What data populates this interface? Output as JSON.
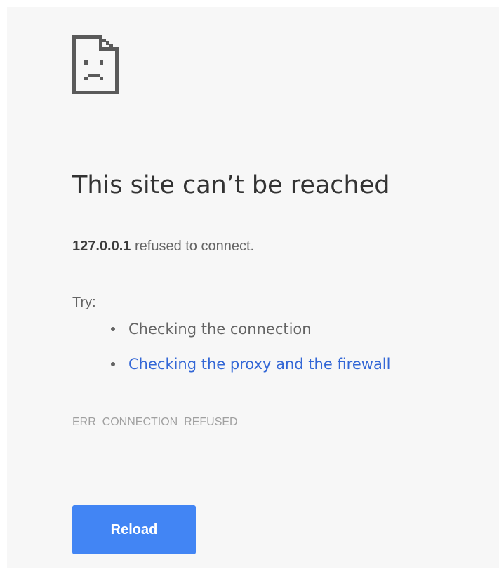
{
  "icon": "sad-page-icon",
  "title": "This site can’t be reached",
  "summary": {
    "host": "127.0.0.1",
    "message": " refused to connect."
  },
  "suggestions": {
    "label": "Try:",
    "items": [
      {
        "label": "Checking the connection",
        "link": false
      },
      {
        "label": "Checking the proxy and the firewall",
        "link": true
      }
    ]
  },
  "error_code": "ERR_CONNECTION_REFUSED",
  "reload_button": {
    "label": "Reload"
  },
  "colors": {
    "background": "#f7f7f7",
    "title": "#333333",
    "text": "#646464",
    "link": "#3367d6",
    "error_code": "#a0a0a0",
    "button": "#4285f4",
    "button_text": "#ffffff"
  }
}
